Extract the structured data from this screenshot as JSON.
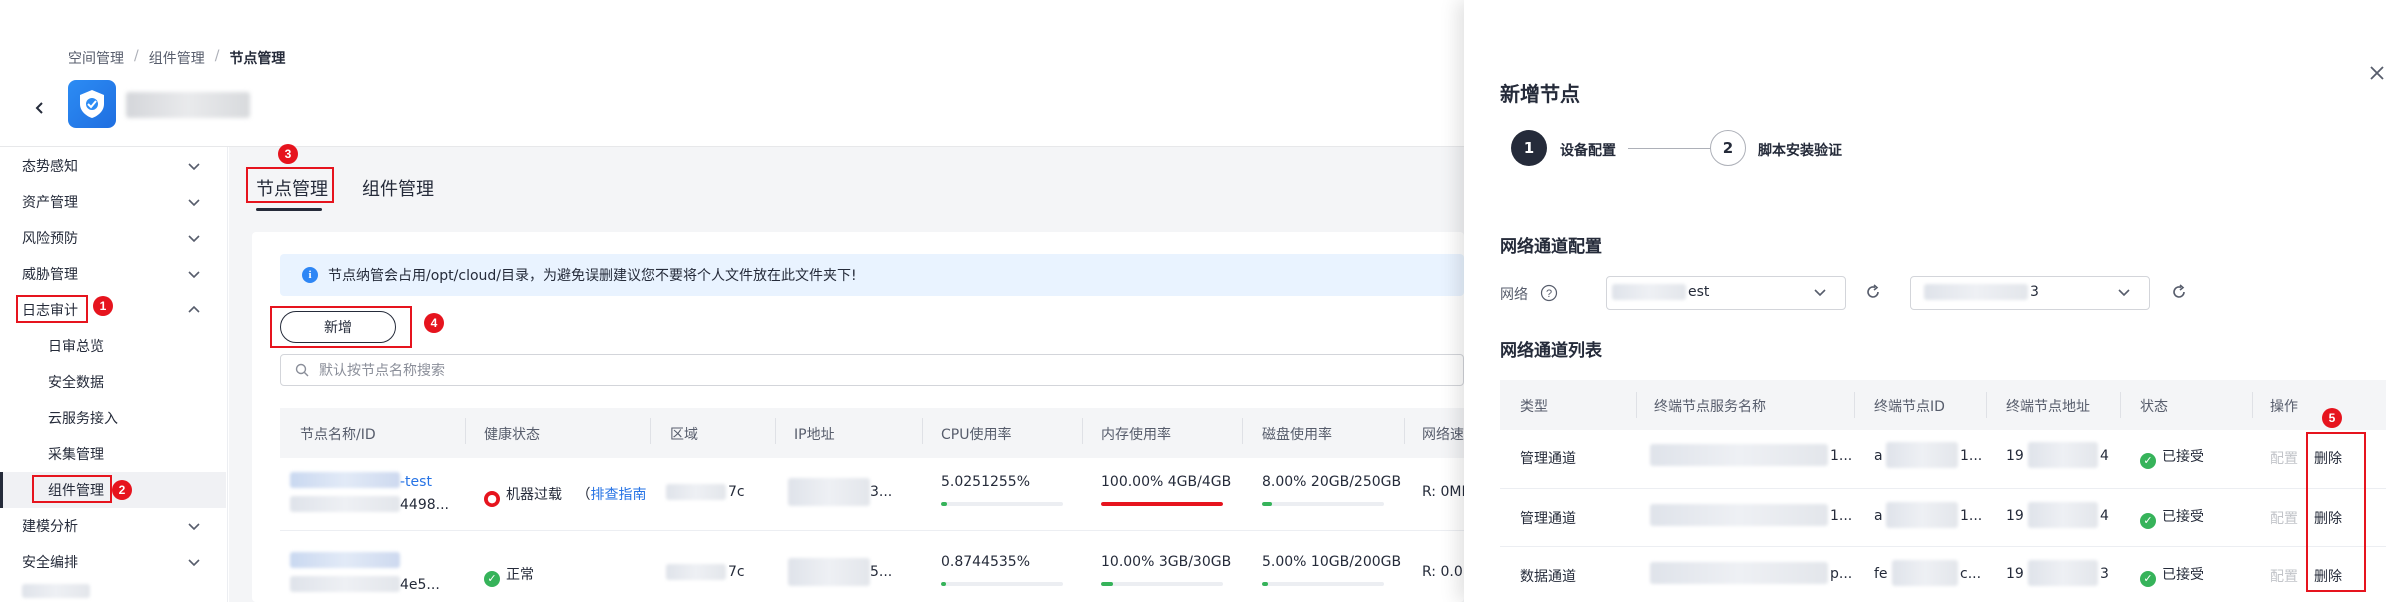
{
  "breadcrumb": [
    "空间管理",
    "组件管理",
    "节点管理"
  ],
  "sidebar": {
    "items": [
      {
        "label": "态势感知",
        "expanded": false
      },
      {
        "label": "资产管理",
        "expanded": false
      },
      {
        "label": "风险预防",
        "expanded": false
      },
      {
        "label": "威胁管理",
        "expanded": false
      },
      {
        "label": "日志审计",
        "expanded": true
      },
      {
        "label": "日审总览",
        "sub": true
      },
      {
        "label": "安全数据",
        "sub": true
      },
      {
        "label": "云服务接入",
        "sub": true
      },
      {
        "label": "采集管理",
        "sub": true
      },
      {
        "label": "组件管理",
        "sub": true,
        "active": true
      },
      {
        "label": "建模分析",
        "expanded": false
      },
      {
        "label": "安全编排",
        "expanded": false
      }
    ]
  },
  "annotations": [
    "1",
    "2",
    "3",
    "4",
    "5"
  ],
  "tabs": [
    {
      "label": "节点管理",
      "active": true
    },
    {
      "label": "组件管理",
      "active": false
    }
  ],
  "banner": {
    "text": "节点纳管会占用/opt/cloud/目录，为避免误删建议您不要将个人文件放在此文件夹下!"
  },
  "buttons": {
    "add": "新增"
  },
  "search": {
    "placeholder": "默认按节点名称搜索"
  },
  "table": {
    "headers": [
      "节点名称/ID",
      "健康状态",
      "区域",
      "IP地址",
      "CPU使用率",
      "内存使用率",
      "磁盘使用率",
      "网络速"
    ],
    "rows": [
      {
        "name_suffix": "-test",
        "id_suffix": "4498...",
        "health": "机器过载",
        "health_link_prefix": "（",
        "health_link": "排查指南",
        "region_suffix": "7c",
        "ip_suffix": "3...",
        "cpu": "5.0251255%",
        "cpu_pct": 5,
        "mem": "100.00%  4GB/4GB",
        "mem_pct": 100,
        "disk": "8.00%  20GB/250GB",
        "disk_pct": 8,
        "net": "R: 0MI"
      },
      {
        "name_suffix": "",
        "id_suffix": "4e5...",
        "health": "正常",
        "health_link_prefix": "",
        "health_link": "",
        "region_suffix": "7c",
        "ip_suffix": "5...",
        "cpu": "0.8744535%",
        "cpu_pct": 1,
        "mem": "10.00%  3GB/30GB",
        "mem_pct": 10,
        "disk": "5.00%  10GB/200GB",
        "disk_pct": 5,
        "net": "R: 0.0"
      }
    ]
  },
  "drawer": {
    "title": "新增节点",
    "steps": [
      {
        "num": "1",
        "label": "设备配置",
        "active": true
      },
      {
        "num": "2",
        "label": "脚本安装验证",
        "active": false
      }
    ],
    "network_config_title": "网络通道配置",
    "network_label": "网络",
    "select1_value_suffix": "est",
    "select2_value_suffix": "3",
    "channel_list_title": "网络通道列表",
    "channel_headers": [
      "类型",
      "终端节点服务名称",
      "终端节点ID",
      "终端节点地址",
      "状态",
      "操作"
    ],
    "channels": [
      {
        "type": "管理通道",
        "name_suffix": "1...",
        "id_prefix": "a",
        "id_suffix": "1...",
        "addr_prefix": "19",
        "addr_suffix": "4",
        "status": "已接受",
        "config": "配置",
        "delete": "删除"
      },
      {
        "type": "管理通道",
        "name_suffix": "1...",
        "id_prefix": "a",
        "id_suffix": "1...",
        "addr_prefix": "19",
        "addr_suffix": "4",
        "status": "已接受",
        "config": "配置",
        "delete": "删除"
      },
      {
        "type": "数据通道",
        "name_suffix": "p...",
        "id_prefix": "fe",
        "id_suffix": "c...",
        "addr_prefix": "19",
        "addr_suffix": "3",
        "status": "已接受",
        "config": "配置",
        "delete": "删除"
      }
    ]
  },
  "colors": {
    "accent": "#2673e5",
    "annotation": "#e6141e",
    "success": "#36b35a",
    "danger": "#e6141e",
    "progress_green": "#36b35a"
  }
}
